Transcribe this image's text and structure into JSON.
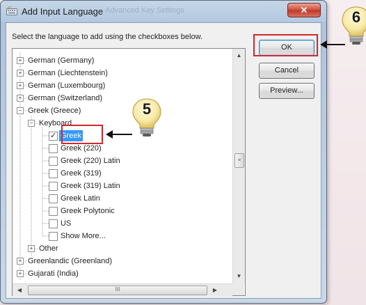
{
  "window": {
    "title": "Add Input Language",
    "title_ghost": "Advanced Key Settings",
    "close_label": "✕"
  },
  "instruction": "Select the language to add using the checkboxes below.",
  "tree": {
    "nodes": [
      {
        "label": "German (Germany)",
        "expander": "+"
      },
      {
        "label": "German (Liechtenstein)",
        "expander": "+"
      },
      {
        "label": "German (Luxembourg)",
        "expander": "+"
      },
      {
        "label": "German (Switzerland)",
        "expander": "+"
      },
      {
        "label": "Greek (Greece)",
        "expander": "−"
      },
      {
        "label": "Keyboard",
        "expander": "−"
      },
      {
        "label": "Greek",
        "checked": true
      },
      {
        "label": "Greek (220)",
        "checked": false
      },
      {
        "label": "Greek (220) Latin",
        "checked": false
      },
      {
        "label": "Greek (319)",
        "checked": false
      },
      {
        "label": "Greek (319) Latin",
        "checked": false
      },
      {
        "label": "Greek Latin",
        "checked": false
      },
      {
        "label": "Greek Polytonic",
        "checked": false
      },
      {
        "label": "US",
        "checked": false
      },
      {
        "label": "Show More...",
        "checked": false
      },
      {
        "label": "Other",
        "expander": "+"
      },
      {
        "label": "Greenlandic (Greenland)",
        "expander": "+"
      },
      {
        "label": "Gujarati (India)",
        "expander": "+"
      }
    ],
    "vscroll_thumb_grip": "≡",
    "hscroll_thumb_grip": "III"
  },
  "buttons": {
    "ok": "OK",
    "cancel": "Cancel",
    "preview": "Preview..."
  },
  "callouts": {
    "step_ok": "6",
    "step_greek": "5",
    "highlight_color": "#d9262c"
  }
}
